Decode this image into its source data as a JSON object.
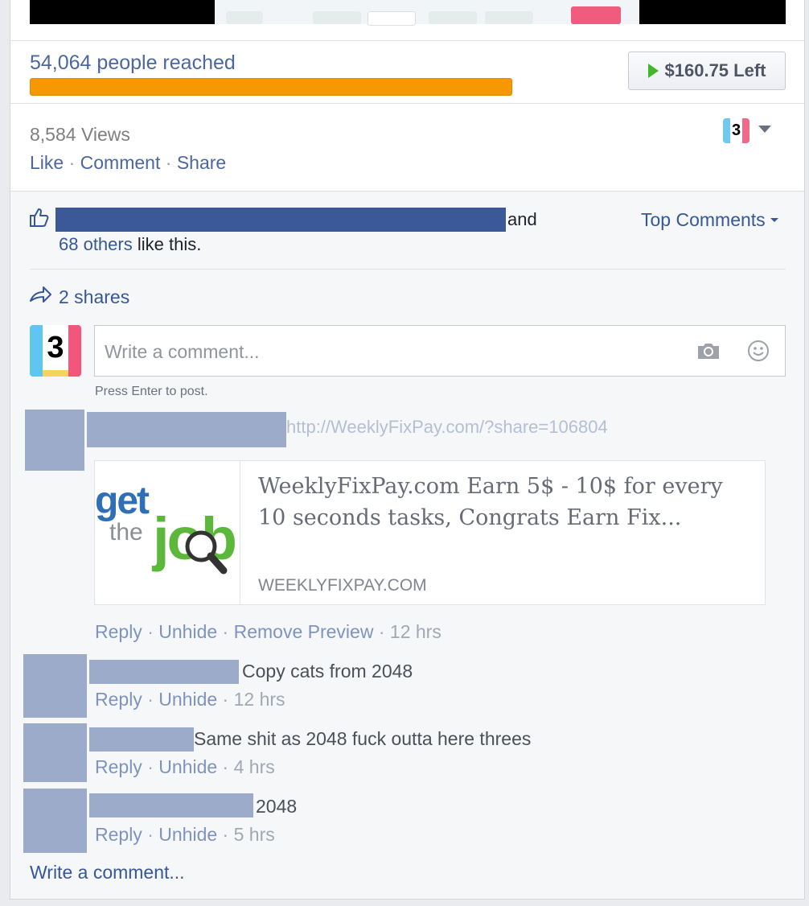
{
  "reach": {
    "text": "54,064 people reached",
    "budget_label": "$160.75 Left"
  },
  "stats": {
    "views": "8,584 Views",
    "like": "Like",
    "comment": "Comment",
    "share": "Share",
    "sep": "·"
  },
  "page_avatar_digit": "3",
  "likes": {
    "and": "and",
    "others": "68 others",
    "suffix": " like this."
  },
  "sort": {
    "label": "Top Comments"
  },
  "shares": {
    "label": "2 shares"
  },
  "composer": {
    "placeholder": "Write a comment...",
    "hint": "Press Enter to post."
  },
  "comments": [
    {
      "text": "http://WeeklyFixPay.com/?share=106804",
      "preview": {
        "title": "WeeklyFixPay.com Earn 5$ - 10$ for every 10 seconds tasks, Congrats Earn Fix...",
        "domain": "WEEKLYFIXPAY.COM",
        "thumb_get": "get",
        "thumb_the": "the",
        "thumb_job": "job"
      },
      "actions": {
        "reply": "Reply",
        "unhide": "Unhide",
        "remove": "Remove Preview"
      },
      "time": "12 hrs"
    },
    {
      "text": "Copy cats from 2048",
      "actions": {
        "reply": "Reply",
        "unhide": "Unhide"
      },
      "time": "12 hrs"
    },
    {
      "text": "Same shit as 2048 fuck outta here threes",
      "actions": {
        "reply": "Reply",
        "unhide": "Unhide"
      },
      "time": "4 hrs"
    },
    {
      "text": "2048",
      "actions": {
        "reply": "Reply",
        "unhide": "Unhide"
      },
      "time": "5 hrs"
    }
  ],
  "footer": {
    "write_comment": "Write a comment..."
  },
  "colors": {
    "link": "#365899",
    "reach_bar": "#f79800",
    "play": "#42b72a",
    "redaction": "#3b5998",
    "redaction_light": "#9cabc9"
  },
  "icons": [
    "play-icon",
    "caret-down-icon",
    "like-icon",
    "share-icon",
    "camera-icon",
    "smiley-icon"
  ]
}
